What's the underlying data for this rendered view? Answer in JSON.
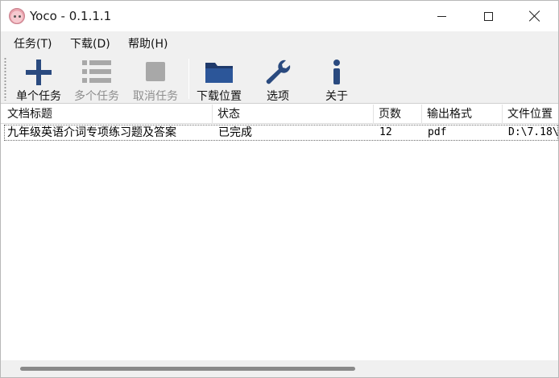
{
  "window": {
    "title": "Yoco - 0.1.1.1"
  },
  "menu": {
    "items": [
      {
        "label": "任务(T)"
      },
      {
        "label": "下载(D)"
      },
      {
        "label": "帮助(H)"
      }
    ]
  },
  "toolbar": {
    "buttons": [
      {
        "label": "单个任务",
        "icon": "plus-icon",
        "enabled": true
      },
      {
        "label": "多个任务",
        "icon": "list-icon",
        "enabled": false
      },
      {
        "label": "取消任务",
        "icon": "stop-icon",
        "enabled": false
      },
      {
        "label": "下载位置",
        "icon": "folder-icon",
        "enabled": true
      },
      {
        "label": "选项",
        "icon": "wrench-icon",
        "enabled": true
      },
      {
        "label": "关于",
        "icon": "info-icon",
        "enabled": true
      }
    ],
    "icon_color": "#2a4a7f",
    "disabled_icon_color": "#a8a8a8"
  },
  "table": {
    "columns": [
      "文档标题",
      "状态",
      "页数",
      "输出格式",
      "文件位置"
    ],
    "rows": [
      {
        "title": "九年级英语介词专项练习题及答案",
        "status": "已完成",
        "pages": "12",
        "format": "pdf",
        "location": "D:\\7.18\\"
      }
    ]
  }
}
